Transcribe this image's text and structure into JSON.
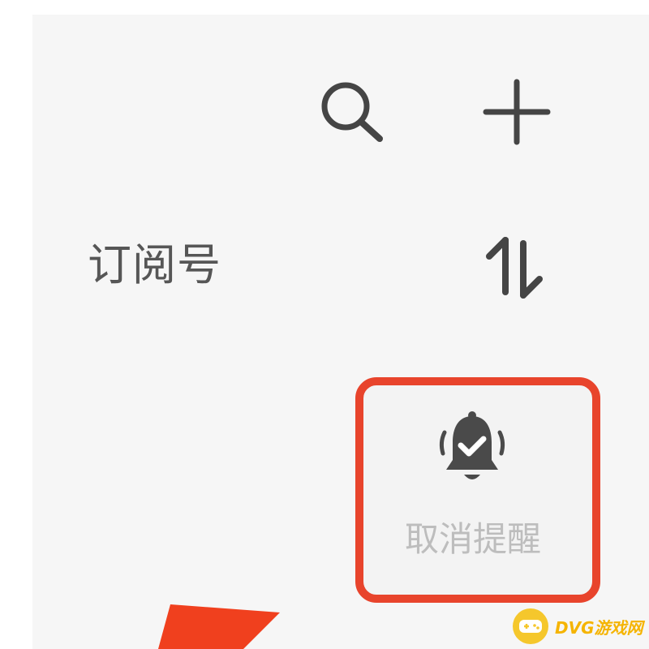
{
  "header": {
    "search_icon": "search-icon",
    "add_icon": "plus-icon"
  },
  "list": {
    "title": "订阅号",
    "sort_icon": "sort-arrows-icon"
  },
  "reminder": {
    "icon": "bell-check-icon",
    "label": "取消提醒"
  },
  "annotation": {
    "highlight_color": "#e8442c",
    "arrow_color": "#f0401e"
  },
  "watermark": {
    "text": "DVG游戏网",
    "color": "#f5b400"
  }
}
